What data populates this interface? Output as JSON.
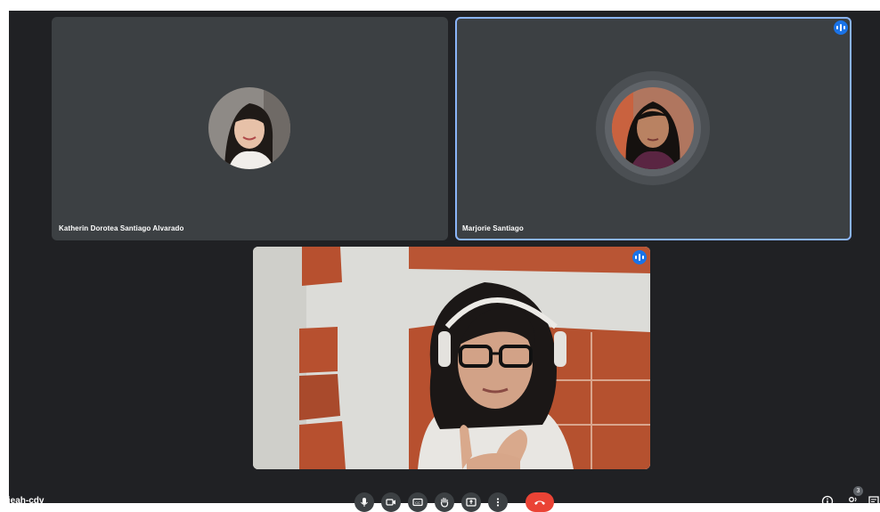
{
  "participants": [
    {
      "name": "Katherin Dorotea Santiago Alvarado",
      "speaking": false
    },
    {
      "name": "Marjorie Santiago",
      "speaking": true
    },
    {
      "name": "",
      "speaking": true,
      "video_on": true
    }
  ],
  "meeting": {
    "code": "v-ieah-cdv",
    "people_count": "3"
  },
  "controls": [
    {
      "name": "microphone-button",
      "icon": "mic-icon"
    },
    {
      "name": "camera-button",
      "icon": "video-icon"
    },
    {
      "name": "captions-button",
      "icon": "captions-icon"
    },
    {
      "name": "raise-hand-button",
      "icon": "hand-icon"
    },
    {
      "name": "present-button",
      "icon": "present-icon"
    },
    {
      "name": "more-options-button",
      "icon": "more-vert-icon"
    },
    {
      "name": "leave-call-button",
      "icon": "call-end-icon"
    }
  ],
  "colors": {
    "background": "#202124",
    "tile": "#3c4043",
    "active_border": "#8ab4f8",
    "speaker_badge": "#1a73e8",
    "hangup": "#ea4335"
  }
}
